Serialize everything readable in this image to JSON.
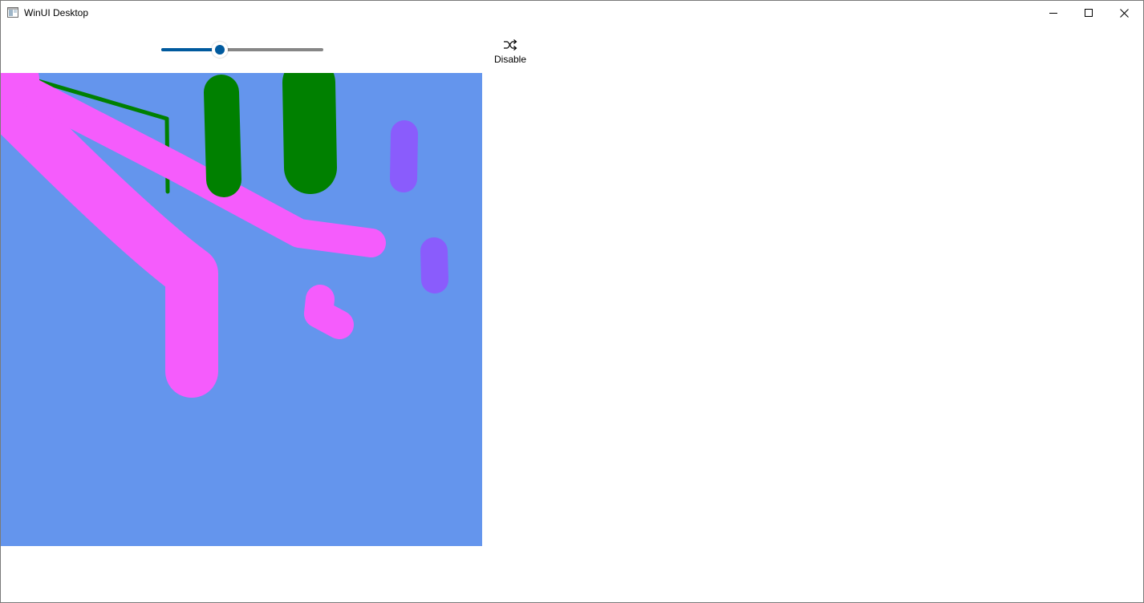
{
  "window": {
    "title": "WinUI Desktop",
    "icons": {
      "app": "app-window-icon",
      "minimize": "minimize-icon",
      "maximize": "maximize-icon",
      "close": "close-icon"
    }
  },
  "toolbar": {
    "slider": {
      "value_fraction": 0.36,
      "accent_color": "#005a9e",
      "track_color": "#868686"
    },
    "toggle_button": {
      "label": "Disable",
      "icon": "shuffle-icon"
    }
  },
  "canvas": {
    "background_color": "#6495ed",
    "ink_colors": {
      "pink": "#f55cfc",
      "green": "#008000",
      "purple": "#8a5cfc"
    }
  }
}
